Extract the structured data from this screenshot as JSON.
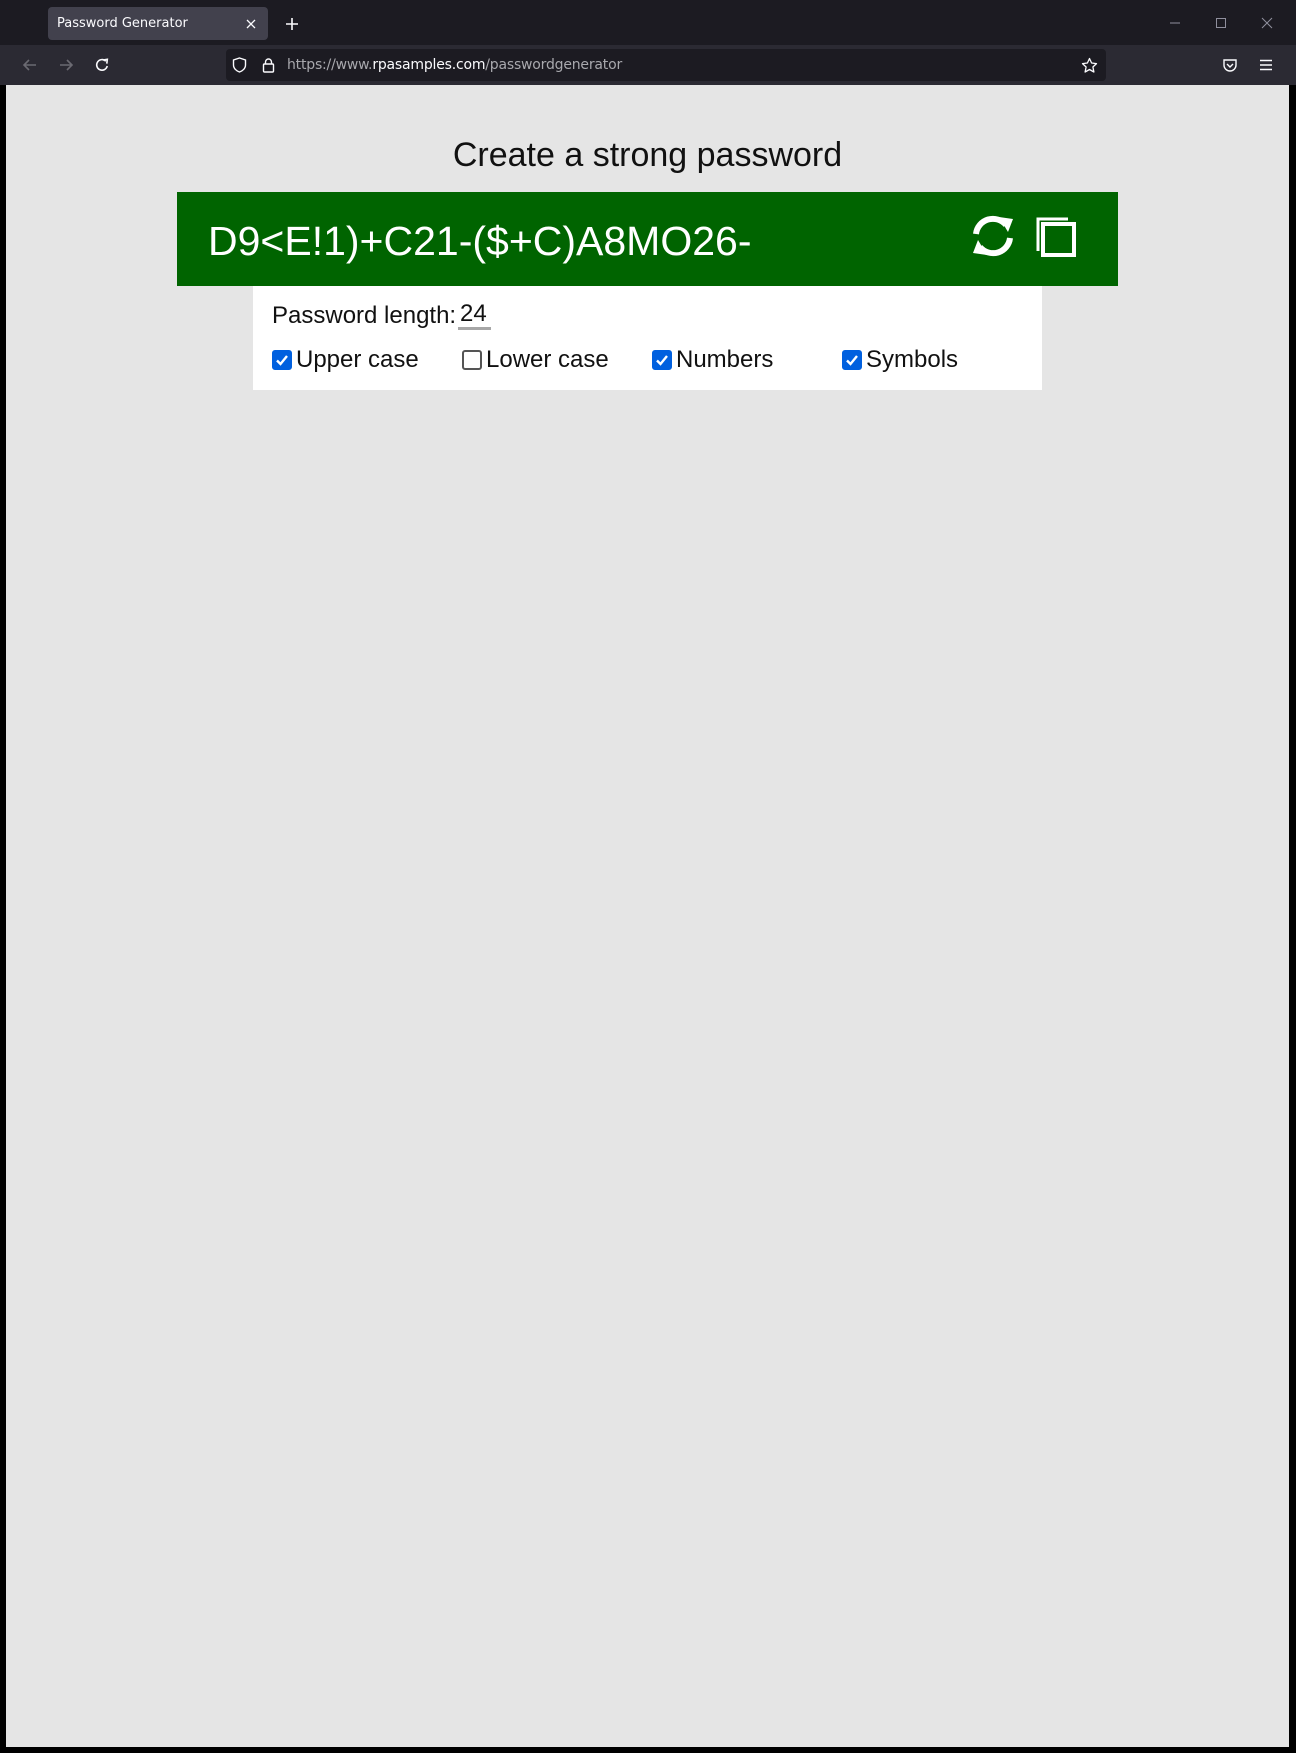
{
  "browser": {
    "tab_title": "Password Generator",
    "url_prefix": "https://www.",
    "url_domain": "rpasamples.com",
    "url_path": "/passwordgenerator"
  },
  "page": {
    "headline": "Create a strong password",
    "password": "D9<E!1)+C21-($+C)A8MO26-",
    "length_label": "Password length:",
    "length_value": "24",
    "options": [
      {
        "label": "Upper case",
        "checked": true
      },
      {
        "label": "Lower case",
        "checked": false
      },
      {
        "label": "Numbers",
        "checked": true
      },
      {
        "label": "Symbols",
        "checked": true
      }
    ]
  },
  "colors": {
    "password_bar": "#006400",
    "checkbox_accent": "#0060df",
    "page_background": "#e5e5e5"
  }
}
